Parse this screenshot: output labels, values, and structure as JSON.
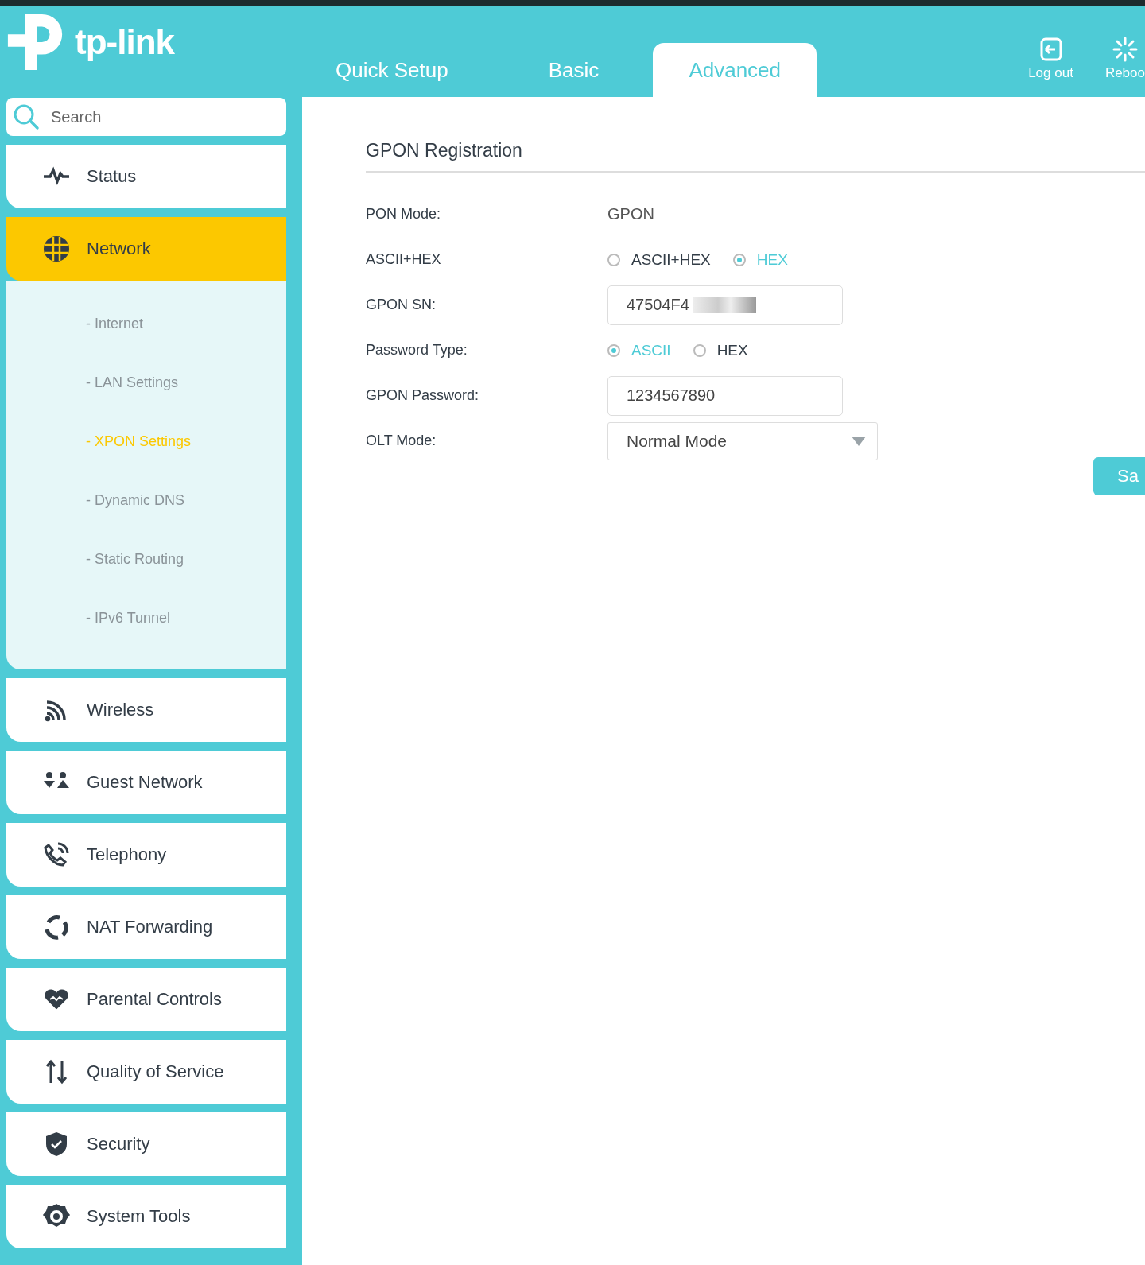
{
  "header": {
    "logo": "tp-link",
    "tabs": [
      {
        "label": "Quick Setup",
        "selected": false
      },
      {
        "label": "Basic",
        "selected": false
      },
      {
        "label": "Advanced",
        "selected": true
      }
    ],
    "actions": [
      {
        "label": "Log out",
        "kind": "logout"
      },
      {
        "label": "Reboo",
        "kind": "reboot"
      }
    ]
  },
  "sidebar": {
    "search": {
      "placeholder": "Search"
    },
    "items": [
      {
        "label": "Status",
        "kind": "pulse",
        "selected": false
      },
      {
        "label": "Network",
        "kind": "globe",
        "selected": true,
        "expanded": true,
        "children": [
          {
            "label": "- Internet",
            "selected": false
          },
          {
            "label": "- LAN Settings",
            "selected": false
          },
          {
            "label": "- XPON Settings",
            "selected": true
          },
          {
            "label": "- Dynamic DNS",
            "selected": false
          },
          {
            "label": "- Static Routing",
            "selected": false
          },
          {
            "label": "- IPv6 Tunnel",
            "selected": false
          }
        ]
      },
      {
        "label": "Wireless",
        "kind": "wifi",
        "selected": false
      },
      {
        "label": "Guest Network",
        "kind": "guests",
        "selected": false
      },
      {
        "label": "Telephony",
        "kind": "phone",
        "selected": false
      },
      {
        "label": "NAT Forwarding",
        "kind": "cycle",
        "selected": false
      },
      {
        "label": "Parental Controls",
        "kind": "heart",
        "selected": false
      },
      {
        "label": "Quality of Service",
        "kind": "updown",
        "selected": false
      },
      {
        "label": "Security",
        "kind": "shield",
        "selected": false
      },
      {
        "label": "System Tools",
        "kind": "gear",
        "selected": false
      }
    ]
  },
  "form": {
    "title": "GPON Registration",
    "rows": [
      {
        "kind": "text",
        "label": "PON Mode:",
        "value": "GPON"
      },
      {
        "kind": "radio",
        "label": "ASCII+HEX",
        "options": [
          {
            "label": "ASCII+HEX",
            "selected": false
          },
          {
            "label": "HEX",
            "selected": true
          }
        ]
      },
      {
        "kind": "input",
        "label": "GPON SN:",
        "value": "47504F4",
        "redacted": true
      },
      {
        "kind": "radio",
        "label": "Password Type:",
        "options": [
          {
            "label": "ASCII",
            "selected": true
          },
          {
            "label": "HEX",
            "selected": false
          }
        ]
      },
      {
        "kind": "input",
        "label": "GPON Password:",
        "value": "1234567890"
      },
      {
        "kind": "select",
        "label": "OLT Mode:",
        "value": "Normal Mode"
      }
    ],
    "save_button": "Sa"
  }
}
